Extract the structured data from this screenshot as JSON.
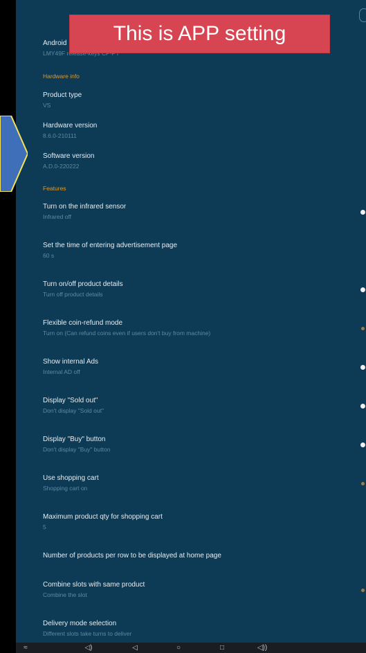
{
  "banner": {
    "text": "This is APP setting"
  },
  "top_item": {
    "title": "Android",
    "subtitle": "LMY49F release-keys CP-PT"
  },
  "sections": {
    "hardware": "Hardware info",
    "features": "Features"
  },
  "hardware_items": [
    {
      "title": "Product type",
      "subtitle": "VS"
    },
    {
      "title": "Hardware version",
      "subtitle": "8.6.0-210111"
    },
    {
      "title": "Software version",
      "subtitle": "A.D.0-220222"
    }
  ],
  "feature_items": [
    {
      "title": "Turn on the infrared sensor",
      "subtitle": "Infrared off",
      "toggle": "off"
    },
    {
      "title": "Set the time of entering advertisement page",
      "subtitle": "60 s",
      "toggle": "none"
    },
    {
      "title": "Turn on/off product details",
      "subtitle": "Turn off product details",
      "toggle": "off"
    },
    {
      "title": "Flexible coin-refund mode",
      "subtitle": "Turn on (Can refund coins even if users don't buy from machine)",
      "toggle": "on"
    },
    {
      "title": "Show internal Ads",
      "subtitle": "Internal AD off",
      "toggle": "off"
    },
    {
      "title": "Display \"Sold out\"",
      "subtitle": "Don't display \"Sold out\"",
      "toggle": "off"
    },
    {
      "title": "Display \"Buy\" button",
      "subtitle": "Don't display \"Buy\" button",
      "toggle": "off"
    },
    {
      "title": "Use shopping cart",
      "subtitle": "Shopping cart on",
      "toggle": "on"
    },
    {
      "title": "Maximum product qty for shopping cart",
      "subtitle": "5",
      "toggle": "none"
    },
    {
      "title": "Number of products per row to be displayed at home page",
      "subtitle": "",
      "toggle": "none"
    },
    {
      "title": "Combine slots with same product",
      "subtitle": "Combine the slot",
      "toggle": "on"
    },
    {
      "title": "Delivery mode selection",
      "subtitle": "Different slots take turns to deliver",
      "toggle": "none"
    }
  ],
  "navbar": {
    "icons": [
      "menu-icon",
      "volume-down-icon",
      "back-icon",
      "home-icon",
      "recents-icon",
      "volume-up-icon"
    ],
    "glyphs": [
      "≈",
      "◁)",
      "◁",
      "○",
      "□",
      "◁))"
    ]
  },
  "colors": {
    "background": "#0d3a55",
    "section_header": "#e39a2b",
    "banner": "#d64551",
    "arrow_fill": "#3f6fb8",
    "arrow_stroke": "#f3e25a"
  }
}
